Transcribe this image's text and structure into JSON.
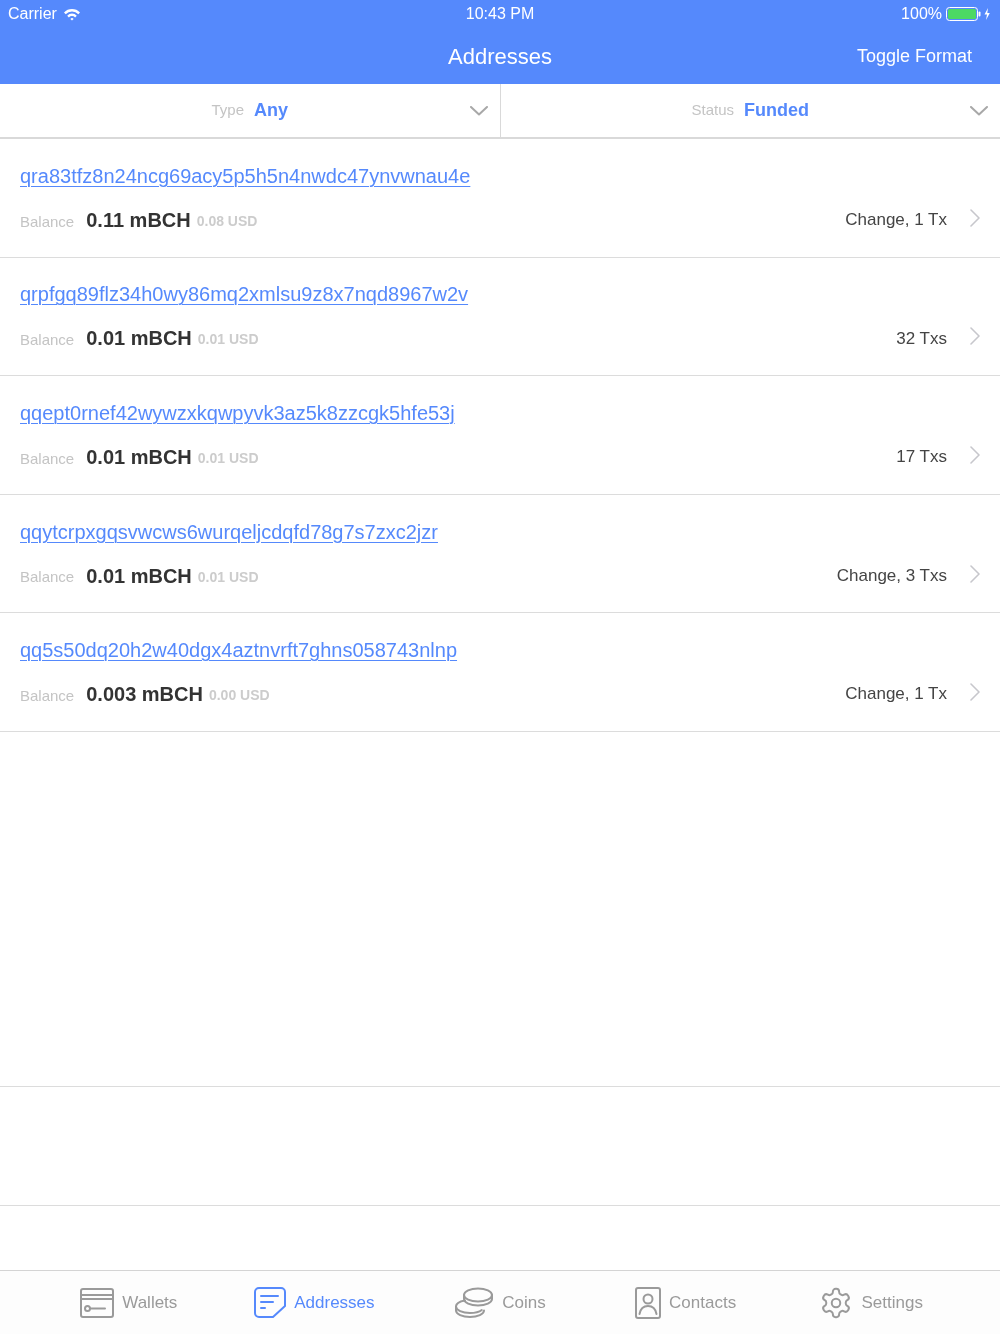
{
  "status_bar": {
    "carrier": "Carrier",
    "time": "10:43 PM",
    "battery": "100%"
  },
  "nav": {
    "title": "Addresses",
    "action": "Toggle Format"
  },
  "filters": [
    {
      "label": "Type",
      "value": "Any"
    },
    {
      "label": "Status",
      "value": "Funded"
    }
  ],
  "addresses": [
    {
      "address": "qra83tfz8n24ncg69acy5p5h5n4nwdc47ynvwnau4e",
      "balance_label": "Balance",
      "balance": "0.11 mBCH",
      "fiat": "0.08 USD",
      "info": "Change, 1 Tx"
    },
    {
      "address": "qrpfgq89flz34h0wy86mq2xmlsu9z8x7nqd8967w2v",
      "balance_label": "Balance",
      "balance": "0.01 mBCH",
      "fiat": "0.01 USD",
      "info": "32 Txs"
    },
    {
      "address": "qqept0rnef42wywzxkqwpyvk3az5k8zzcgk5hfe53j",
      "balance_label": "Balance",
      "balance": "0.01 mBCH",
      "fiat": "0.01 USD",
      "info": "17 Txs"
    },
    {
      "address": "qqytcrpxgqsvwcws6wurqeljcdqfd78g7s7zxc2jzr",
      "balance_label": "Balance",
      "balance": "0.01 mBCH",
      "fiat": "0.01 USD",
      "info": "Change, 3 Txs"
    },
    {
      "address": "qq5s50dq20h2w40dgx4aztnvrft7ghns058743nlnp",
      "balance_label": "Balance",
      "balance": "0.003 mBCH",
      "fiat": "0.00 USD",
      "info": "Change, 1 Tx"
    }
  ],
  "tab_bar": [
    {
      "kind": "wallets",
      "label": "Wallets",
      "selected": false
    },
    {
      "kind": "addresses",
      "label": "Addresses",
      "selected": true
    },
    {
      "kind": "coins",
      "label": "Coins",
      "selected": false
    },
    {
      "kind": "contacts",
      "label": "Contacts",
      "selected": false
    },
    {
      "kind": "settings",
      "label": "Settings",
      "selected": false
    }
  ]
}
